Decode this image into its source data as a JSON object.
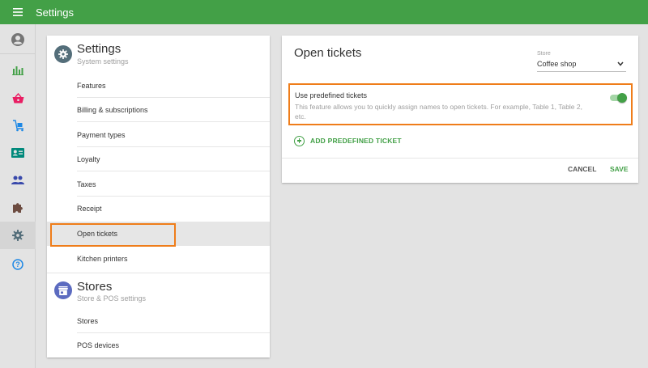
{
  "header": {
    "title": "Settings",
    "menu_icon": "hamburger-icon"
  },
  "rail": {
    "items": [
      {
        "name": "account-icon",
        "color": "#757575"
      },
      {
        "name": "reports-icon",
        "color": "#43a047"
      },
      {
        "name": "items-basket-icon",
        "color": "#e91e63"
      },
      {
        "name": "inventory-icon",
        "color": "#1e88e5"
      },
      {
        "name": "customers-card-icon",
        "color": "#00897b"
      },
      {
        "name": "employees-icon",
        "color": "#3949ab"
      },
      {
        "name": "integrations-puzzle-icon",
        "color": "#6d4c41"
      },
      {
        "name": "settings-gear-icon",
        "color": "#546e7a",
        "active": true
      },
      {
        "name": "help-icon",
        "color": "#1e88e5"
      }
    ]
  },
  "settings_nav": {
    "section1": {
      "title": "Settings",
      "subtitle": "System settings"
    },
    "items1": [
      "Features",
      "Billing & subscriptions",
      "Payment types",
      "Loyalty",
      "Taxes",
      "Receipt",
      "Open tickets",
      "Kitchen printers"
    ],
    "active_item": "Open tickets",
    "section2": {
      "title": "Stores",
      "subtitle": "Store & POS settings"
    },
    "items2": [
      "Stores",
      "POS devices"
    ]
  },
  "panel": {
    "title": "Open tickets",
    "store_label": "Store",
    "store_value": "Coffee shop",
    "toggle": {
      "title": "Use predefined tickets",
      "description": "This feature allows you to quickly assign names to open tickets. For example, Table 1, Table 2, etc.",
      "enabled": true
    },
    "add_label": "ADD PREDEFINED TICKET",
    "cancel_label": "CANCEL",
    "save_label": "SAVE"
  },
  "colors": {
    "brand": "#43a047",
    "highlight": "#ef7d1a"
  }
}
